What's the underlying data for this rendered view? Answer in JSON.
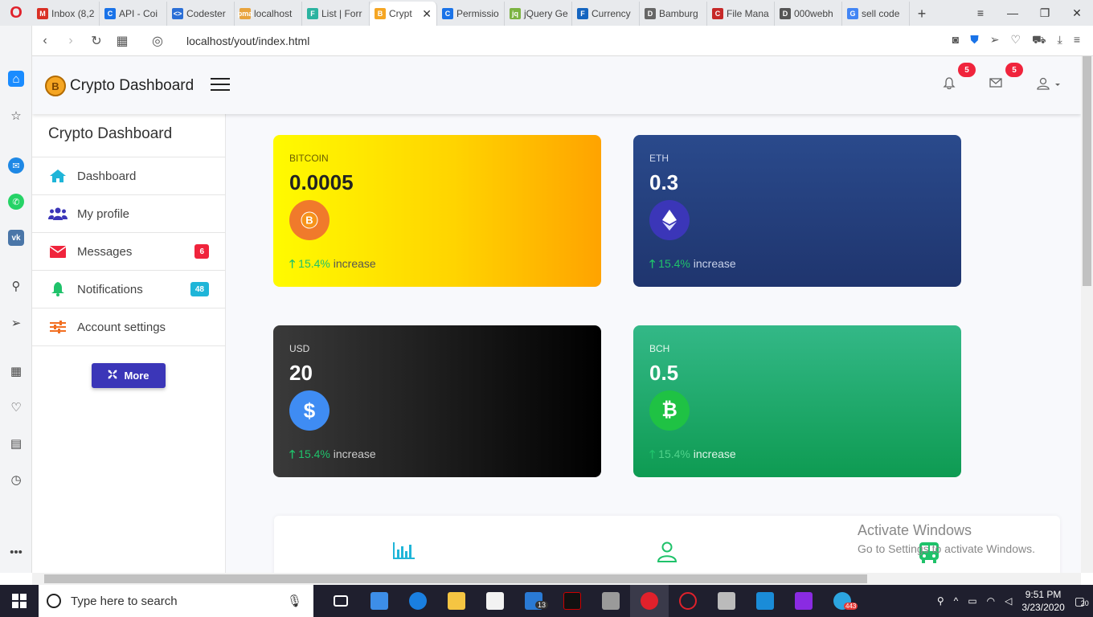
{
  "browser": {
    "tabs": [
      {
        "label": "Inbox (8,2",
        "color": "#d93025",
        "glyph": "M"
      },
      {
        "label": "API - Coi",
        "color": "#1a73e8",
        "glyph": "C"
      },
      {
        "label": "Codester",
        "color": "#2b6fd6",
        "glyph": "<>"
      },
      {
        "label": "localhost",
        "color": "#e8a33d",
        "glyph": "pma"
      },
      {
        "label": "List | Forr",
        "color": "#2bb3a0",
        "glyph": "F"
      },
      {
        "label": "Crypt",
        "color": "#f5a623",
        "glyph": "B",
        "active": true
      },
      {
        "label": "Permissio",
        "color": "#1a73e8",
        "glyph": "C"
      },
      {
        "label": "jQuery Ge",
        "color": "#7cb342",
        "glyph": "jq"
      },
      {
        "label": "Currency",
        "color": "#1565c0",
        "glyph": "F"
      },
      {
        "label": "Bamburg",
        "color": "#666666",
        "glyph": "D"
      },
      {
        "label": "File Mana",
        "color": "#c62828",
        "glyph": "C"
      },
      {
        "label": "000webh",
        "color": "#555555",
        "glyph": "D"
      },
      {
        "label": "sell code",
        "color": "#4285f4",
        "glyph": "G"
      }
    ],
    "url": "localhost/yout/index.html"
  },
  "header": {
    "brand_title": "Crypto Dashboard",
    "notifications_count": "5",
    "messages_count": "5"
  },
  "sidebar": {
    "title": "Crypto Dashboard",
    "items": [
      {
        "label": "Dashboard",
        "icon": "home-icon",
        "color": "#1fb5d8"
      },
      {
        "label": "My profile",
        "icon": "users-icon",
        "color": "#3b36b8"
      },
      {
        "label": "Messages",
        "icon": "envelope-icon",
        "color": "#f0243c",
        "badge": "6",
        "badge_color": "#f0243c"
      },
      {
        "label": "Notifications",
        "icon": "bell-icon",
        "color": "#1fc26a",
        "badge": "48",
        "badge_color": "#1fb5d8"
      },
      {
        "label": "Account settings",
        "icon": "sliders-icon",
        "color": "#f26f21"
      }
    ],
    "more_label": "More"
  },
  "cards": [
    {
      "label": "BITCOIN",
      "value": "0.0005",
      "pct": "15.4%",
      "suffix": "increase",
      "icon": "bitcoin-icon"
    },
    {
      "label": "ETH",
      "value": "0.3",
      "pct": "15.4%",
      "suffix": "increase",
      "icon": "ethereum-icon"
    },
    {
      "label": "USD",
      "value": "20",
      "pct": "15.4%",
      "suffix": "increase",
      "icon": "dollar-icon"
    },
    {
      "label": "BCH",
      "value": "0.5",
      "pct": "15.4%",
      "suffix": "increase",
      "icon": "bitcoin-cash-icon"
    }
  ],
  "watermark": {
    "line1": "Activate Windows",
    "line2": "Go to Settings to activate Windows."
  },
  "taskbar": {
    "search_placeholder": "Type here to search",
    "time": "9:51 PM",
    "date": "3/23/2020",
    "notification_count": "20",
    "mail_badge": "13",
    "telegram_badge": "443"
  }
}
